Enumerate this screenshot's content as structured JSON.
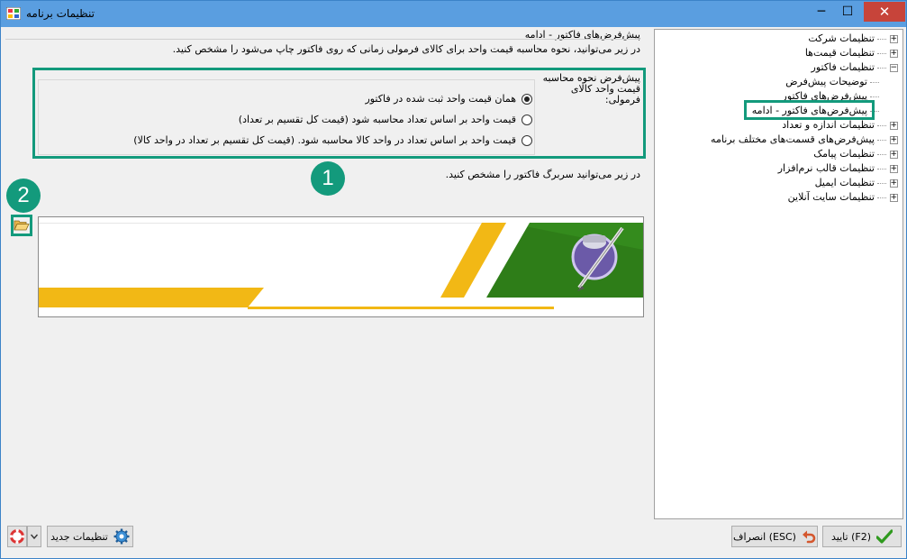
{
  "window": {
    "title": "تنظیمات برنامه",
    "minimize": "─",
    "maximize": "☐",
    "close": "✕"
  },
  "tree": {
    "items": [
      {
        "label": "تنظیمات شرکت",
        "expander": "+"
      },
      {
        "label": "تنظیمات قیمت‌ها",
        "expander": "+"
      },
      {
        "label": "تنظیمات فاکتور",
        "expander": "−"
      },
      {
        "label": "توضیحات پیش‌فرض",
        "expander": ""
      },
      {
        "label": "پیش‌فرض‌های فاکتور",
        "expander": ""
      },
      {
        "label": "پیش‌فرض‌های فاکتور - ادامه",
        "expander": ""
      },
      {
        "label": "تنظیمات اندازه و تعداد",
        "expander": "+"
      },
      {
        "label": "پیش‌فرض‌های قسمت‌های مختلف برنامه",
        "expander": "+"
      },
      {
        "label": "تنظیمات پیامک",
        "expander": "+"
      },
      {
        "label": "تنظیمات قالب نرم‌افزار",
        "expander": "+"
      },
      {
        "label": "تنظیمات ایمیل",
        "expander": "+"
      },
      {
        "label": "تنظیمات سایت آنلاین",
        "expander": "+"
      }
    ]
  },
  "main": {
    "title": "پیش‌فرض‌های فاکتور - ادامه",
    "description": "در زیر می‌توانید، نحوه محاسبه قیمت واحد برای کالای فرمولی زمانی که روی فاکتور چاپ می‌شود را مشخص کنید.",
    "side_label": "پیش‌فرض نحوه محاسبه قیمت واحد کالای فرمولی:",
    "options": [
      {
        "label": "همان قیمت واحد ثبت شده در فاکتور",
        "checked": true
      },
      {
        "label": "قیمت واحد بر اساس تعداد محاسبه شود (قیمت کل تقسیم بر تعداد)",
        "checked": false
      },
      {
        "label": "قیمت واحد بر اساس تعداد در واحد کالا محاسبه شود. (قیمت کل تقسیم بر تعداد در واحد کالا)",
        "checked": false
      }
    ],
    "header_description": "در زیر می‌توانید سربرگ فاکتور را مشخص کنید."
  },
  "annotations": {
    "badge_1": "1",
    "badge_2": "2",
    "color": "#139a7c"
  },
  "buttons": {
    "ok": "(F2) تایید",
    "cancel": "(ESC) انصراف",
    "new_settings": "تنظیمات جدید"
  },
  "colors": {
    "titlebar": "#5a9ee0",
    "close": "#c7443a",
    "banner_green": "#2e7d18",
    "banner_yellow": "#f2b815",
    "annotation": "#139a7c"
  }
}
